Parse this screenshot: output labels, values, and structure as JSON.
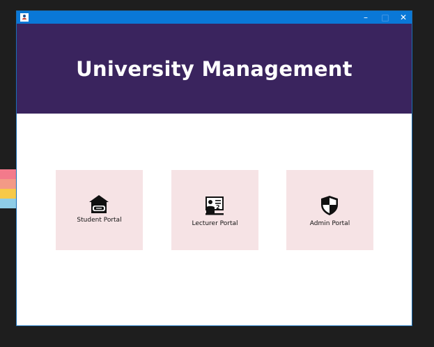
{
  "window": {
    "title": "",
    "controls": {
      "minimize": "–",
      "maximize": "□",
      "close": "✕"
    },
    "accent_color": "#0a78d7"
  },
  "header": {
    "title": "University Management",
    "background": "#3a245e"
  },
  "portals": [
    {
      "label": "Student Portal",
      "icon": "student-home-icon"
    },
    {
      "label": "Lecturer Portal",
      "icon": "lecturer-board-icon"
    },
    {
      "label": "Admin Portal",
      "icon": "shield-icon"
    }
  ],
  "card_color": "#f6e3e5"
}
